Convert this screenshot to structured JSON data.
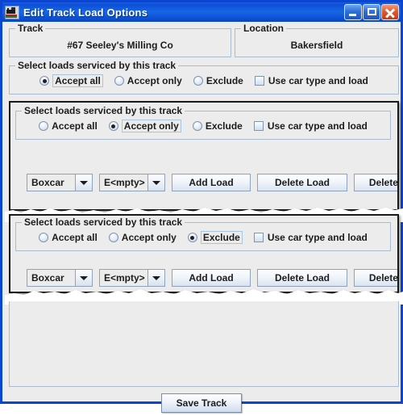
{
  "window": {
    "title": "Edit Track Load Options",
    "icon": "locomotive-icon",
    "accent_color": "#0a46d2",
    "face_color": "#ececec",
    "buttons": {
      "minimize": "minimize-icon",
      "maximize": "maximize-icon",
      "close": "close-icon"
    }
  },
  "track_panel": {
    "legend": "Track",
    "value": "#67 Seeley's Milling Co"
  },
  "location_panel": {
    "legend": "Location",
    "value": "Bakersfield"
  },
  "groups": [
    {
      "legend": "Select loads serviced by this track",
      "options": [
        {
          "label": "Accept all",
          "selected": true,
          "focused": true
        },
        {
          "label": "Accept only",
          "selected": false,
          "focused": false
        },
        {
          "label": "Exclude",
          "selected": false,
          "focused": false
        }
      ],
      "checkbox": {
        "label": "Use car type and load",
        "checked": false
      },
      "has_controls": false
    },
    {
      "legend": "Select loads serviced by this track",
      "options": [
        {
          "label": "Accept all",
          "selected": false,
          "focused": false
        },
        {
          "label": "Accept only",
          "selected": true,
          "focused": true
        },
        {
          "label": "Exclude",
          "selected": false,
          "focused": false
        }
      ],
      "checkbox": {
        "label": "Use car type and load",
        "checked": false
      },
      "has_controls": true,
      "controls": {
        "car_type_combo": {
          "value": "Boxcar",
          "arrow": "chevron-down-icon"
        },
        "load_combo": {
          "value": "E<mpty>",
          "arrow": "chevron-down-icon"
        },
        "add_load_label": "Add Load",
        "delete_load_label": "Delete Load",
        "delete_all_label": "Delete All"
      }
    },
    {
      "legend": "Select loads serviced by this track",
      "options": [
        {
          "label": "Accept all",
          "selected": false,
          "focused": false
        },
        {
          "label": "Accept only",
          "selected": false,
          "focused": false
        },
        {
          "label": "Exclude",
          "selected": true,
          "focused": true
        }
      ],
      "checkbox": {
        "label": "Use car type and load",
        "checked": false
      },
      "has_controls": true,
      "controls": {
        "car_type_combo": {
          "value": "Boxcar",
          "arrow": "chevron-down-icon"
        },
        "load_combo": {
          "value": "E<mpty>",
          "arrow": "chevron-down-icon"
        },
        "add_load_label": "Add Load",
        "delete_load_label": "Delete Load",
        "delete_all_label": "Delete All"
      }
    }
  ],
  "footer": {
    "save_label": "Save Track"
  }
}
